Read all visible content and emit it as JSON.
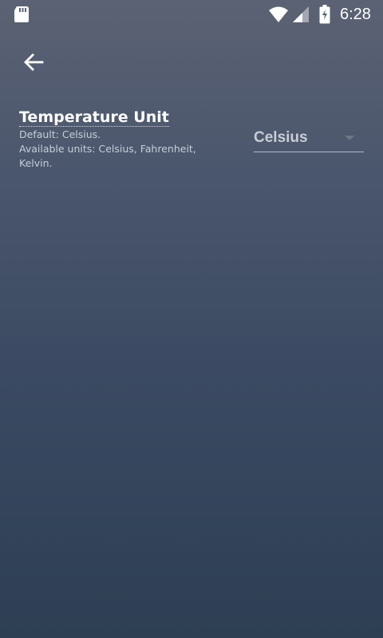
{
  "status_bar": {
    "time": "6:28",
    "icons": [
      "sd-card-icon",
      "wifi-icon",
      "cell-signal-icon",
      "battery-charging-icon"
    ]
  },
  "toolbar": {
    "back_icon": "arrow-back-icon"
  },
  "setting": {
    "title": "Temperature Unit",
    "description_lines": [
      "Default: Celsius.",
      "Available units: Celsius, Fahrenheit,",
      "Kelvin."
    ],
    "selected_value": "Celsius"
  },
  "colors": {
    "background_top": "#5b6273",
    "background_bottom": "#2e3f54",
    "text_primary": "#ffffff",
    "dropdown_text": "#c8cdd6"
  }
}
